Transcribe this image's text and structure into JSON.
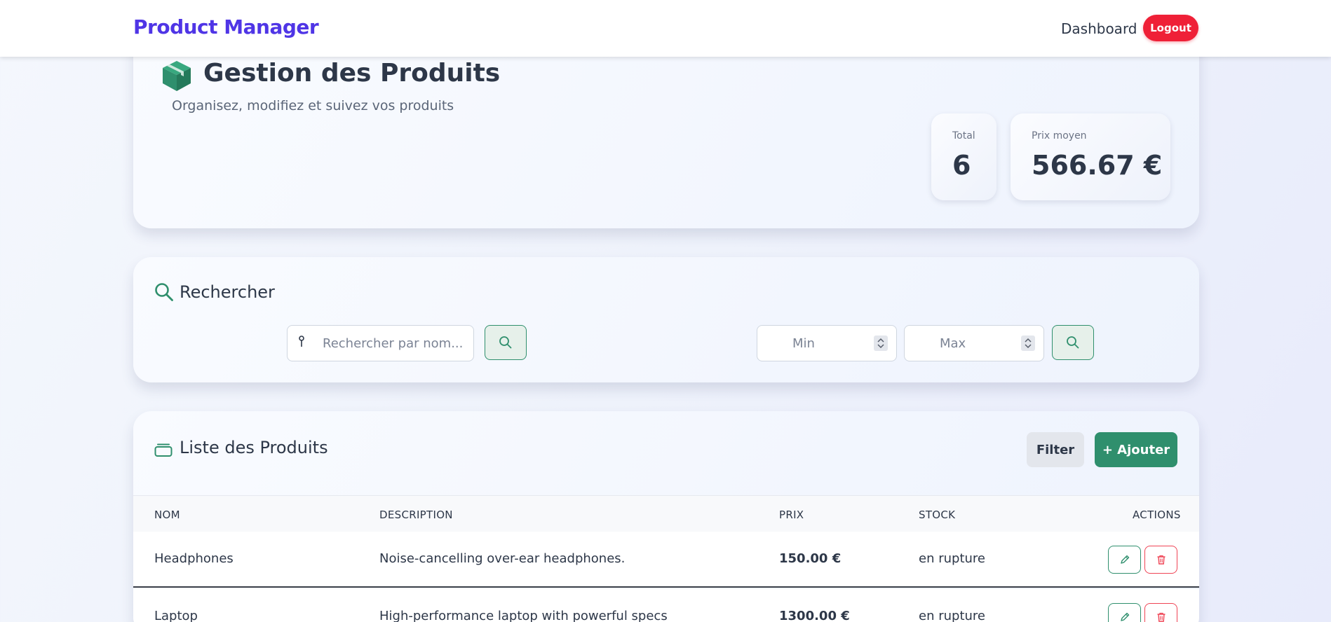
{
  "nav": {
    "brand": "Product Manager",
    "dashboard": "Dashboard",
    "logout": "Logout"
  },
  "header": {
    "title": "Gestion des Produits",
    "subtitle": "Organisez, modifiez et suivez vos produits",
    "stats": {
      "total_label": "Total",
      "total_value": "6",
      "avg_label": "Prix moyen",
      "avg_value": "566.67 €"
    }
  },
  "search": {
    "title": "Rechercher",
    "name_placeholder": "Rechercher par nom...",
    "min_placeholder": "Min",
    "max_placeholder": "Max"
  },
  "list": {
    "title": "Liste des Produits",
    "filter": "Filter",
    "add": "+ Ajouter",
    "columns": [
      "NOM",
      "DESCRIPTION",
      "PRIX",
      "STOCK",
      "ACTIONS"
    ],
    "rows": [
      {
        "name": "Headphones",
        "description": "Noise-cancelling over-ear headphones.",
        "price": "150.00 €",
        "stock": "en rupture"
      },
      {
        "name": "Laptop",
        "description": "High-performance laptop with powerful specs",
        "price": "1300.00 €",
        "stock": "en rupture"
      }
    ]
  },
  "colors": {
    "brand": "#4f35e6",
    "logout": "#ef2037",
    "accent": "#2f8f6d",
    "danger": "#ef4455"
  },
  "icons": [
    "box-icon",
    "search-icon",
    "pin-icon",
    "list-icon",
    "edit-icon",
    "trash-icon"
  ]
}
